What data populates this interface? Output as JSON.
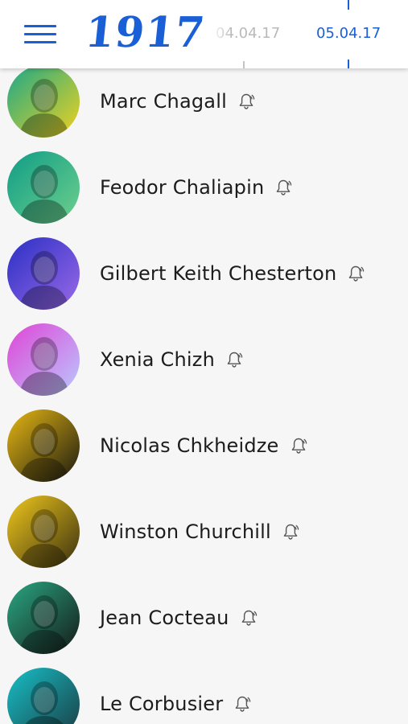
{
  "header": {
    "menu_icon": "hamburger-menu-icon",
    "logo": "1917",
    "dates": {
      "previous": "04.04.17",
      "current": "05.04.17"
    },
    "accent_color": "#1a5fd6"
  },
  "people": [
    {
      "name": "Marc Chagall",
      "bell_icon": "notification-bell-icon",
      "avatar_tint": [
        "#1aa88a",
        "#f0d21e"
      ]
    },
    {
      "name": "Feodor Chaliapin",
      "bell_icon": "notification-bell-icon",
      "avatar_tint": [
        "#0f9c86",
        "#6ed08c"
      ]
    },
    {
      "name": "Gilbert Keith Chesterton",
      "bell_icon": "notification-bell-icon",
      "avatar_tint": [
        "#2a2fc4",
        "#9a6ae8"
      ]
    },
    {
      "name": "Xenia Chizh",
      "bell_icon": "notification-bell-icon",
      "avatar_tint": [
        "#e044d6",
        "#b9c9ff"
      ]
    },
    {
      "name": "Nicolas Chkheidze",
      "bell_icon": "notification-bell-icon",
      "avatar_tint": [
        "#e8b814",
        "#1a1a10"
      ]
    },
    {
      "name": "Winston Churchill",
      "bell_icon": "notification-bell-icon",
      "avatar_tint": [
        "#f0c81c",
        "#3a3010"
      ]
    },
    {
      "name": "Jean Cocteau",
      "bell_icon": "notification-bell-icon",
      "avatar_tint": [
        "#2aa882",
        "#151a18"
      ]
    },
    {
      "name": "Le Corbusier",
      "bell_icon": "notification-bell-icon",
      "avatar_tint": [
        "#18c0c8",
        "#1a3a40"
      ]
    }
  ]
}
